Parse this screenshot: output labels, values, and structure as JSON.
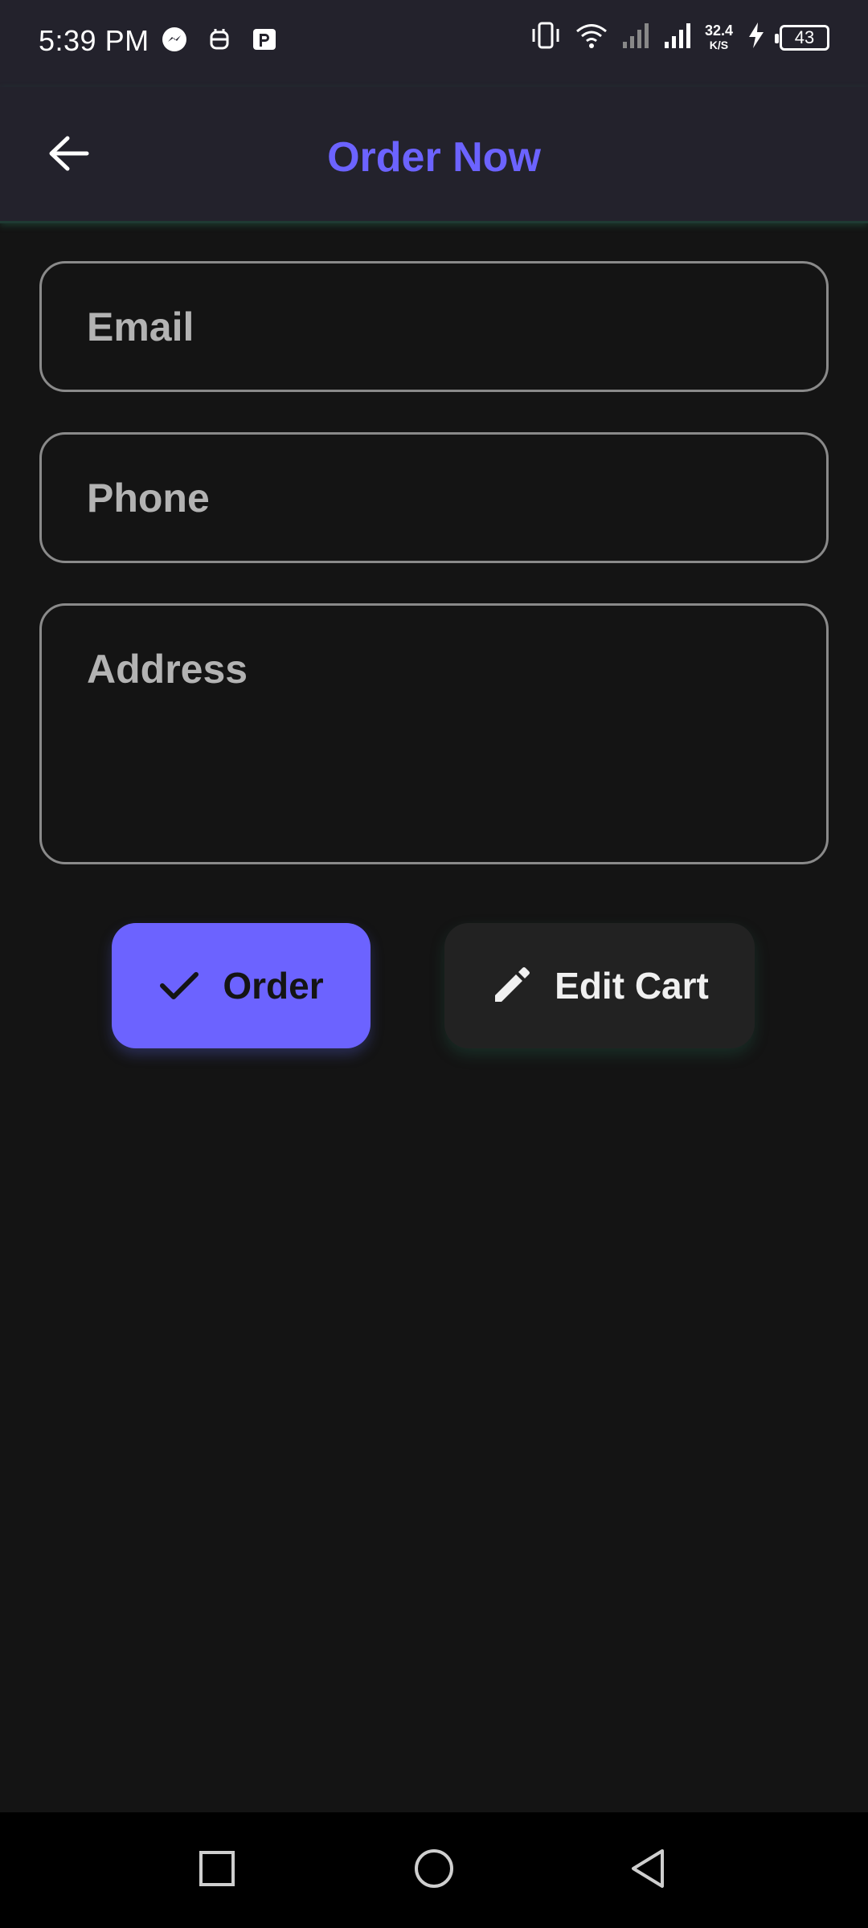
{
  "status_bar": {
    "time": "5:39 PM",
    "left_icons": [
      "messenger-icon",
      "bot-icon",
      "parking-icon"
    ],
    "right_icons": [
      "vibrate-icon",
      "wifi-icon",
      "signal-icon",
      "signal-icon",
      "charging-icon"
    ],
    "net_speed_value": "32.4",
    "net_speed_unit": "K/S",
    "battery_level": "43"
  },
  "app_bar": {
    "title": "Order Now",
    "back_icon": "arrow-left-icon",
    "title_color": "#6c63ff"
  },
  "form": {
    "email": {
      "placeholder": "Email",
      "value": ""
    },
    "phone": {
      "placeholder": "Phone",
      "value": ""
    },
    "address": {
      "placeholder": "Address",
      "value": ""
    }
  },
  "buttons": {
    "order": {
      "label": "Order",
      "icon": "check-icon",
      "color": "#6c63ff"
    },
    "edit_cart": {
      "label": "Edit Cart",
      "icon": "pencil-icon"
    }
  },
  "nav_bar": {
    "items": [
      "square-recent-icon",
      "circle-home-icon",
      "triangle-back-icon"
    ]
  }
}
